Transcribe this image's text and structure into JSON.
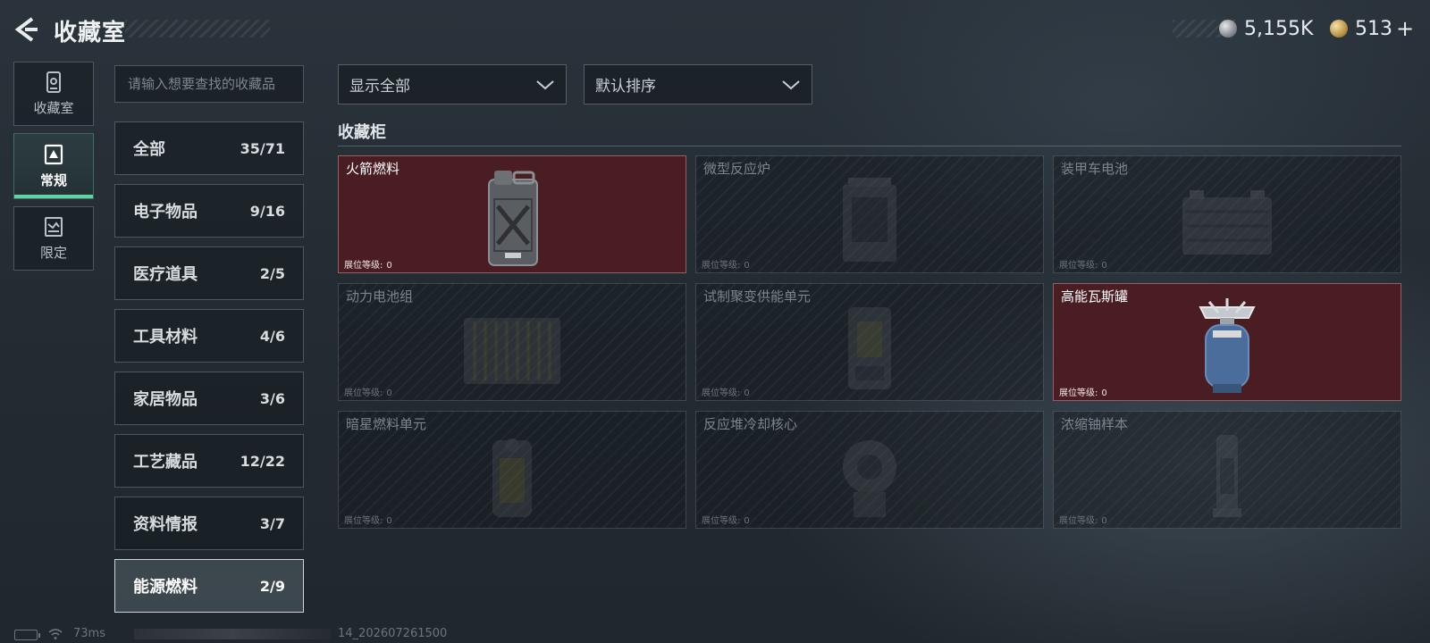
{
  "header": {
    "title": "收藏室",
    "currencies": [
      {
        "icon": "silver-coin-icon",
        "value": "5,155K"
      },
      {
        "icon": "gold-coin-icon",
        "value": "513",
        "suffix": "+"
      }
    ]
  },
  "side_tabs": [
    {
      "label": "收藏室",
      "icon": "collection-room-icon"
    },
    {
      "label": "常规",
      "icon": "regular-icon",
      "active": true
    },
    {
      "label": "限定",
      "icon": "limited-icon"
    }
  ],
  "search": {
    "placeholder": "请输入想要查找的收藏品"
  },
  "categories": [
    {
      "label": "全部",
      "count": "35/71"
    },
    {
      "label": "电子物品",
      "count": "9/16"
    },
    {
      "label": "医疗道具",
      "count": "2/5"
    },
    {
      "label": "工具材料",
      "count": "4/6"
    },
    {
      "label": "家居物品",
      "count": "3/6"
    },
    {
      "label": "工艺藏品",
      "count": "12/22"
    },
    {
      "label": "资料情报",
      "count": "3/7"
    },
    {
      "label": "能源燃料",
      "count": "2/9",
      "active": true
    }
  ],
  "filters": {
    "display": "显示全部",
    "sort": "默认排序"
  },
  "section": {
    "title": "收藏柜"
  },
  "level_label": "展位等级:",
  "items": [
    {
      "name": "火箭燃料",
      "level": "0",
      "owned": true,
      "icon": "fuel-jerrycan-icon"
    },
    {
      "name": "微型反应炉",
      "level": "0",
      "owned": false,
      "icon": "micro-reactor-icon"
    },
    {
      "name": "装甲车电池",
      "level": "0",
      "owned": false,
      "icon": "vehicle-battery-icon"
    },
    {
      "name": "动力电池组",
      "level": "0",
      "owned": false,
      "icon": "battery-pack-icon"
    },
    {
      "name": "试制聚变供能单元",
      "level": "0",
      "owned": false,
      "icon": "fusion-unit-icon"
    },
    {
      "name": "高能瓦斯罐",
      "level": "0",
      "owned": true,
      "icon": "gas-canister-icon"
    },
    {
      "name": "暗星燃料单元",
      "level": "0",
      "owned": false,
      "icon": "fuel-cell-icon"
    },
    {
      "name": "反应堆冷却核心",
      "level": "0",
      "owned": false,
      "icon": "reactor-core-icon"
    },
    {
      "name": "浓缩铀样本",
      "level": "0",
      "owned": false,
      "icon": "uranium-sample-icon"
    }
  ],
  "footer": {
    "ping": "73ms",
    "build": "14_202607261500"
  },
  "colors": {
    "owned_card": "#4a1d22",
    "accent": "#5fd3a5"
  }
}
